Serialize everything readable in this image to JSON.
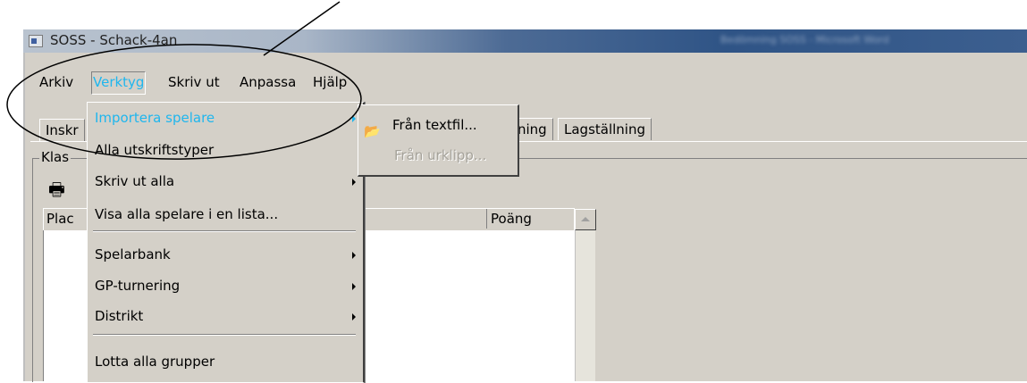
{
  "window": {
    "title": "SOSS - Schack-4an",
    "blurred_title": "Bedömning SOSS - Microsoft Word"
  },
  "menubar": {
    "items": [
      {
        "label": "Arkiv"
      },
      {
        "label": "Verktyg",
        "active": true
      },
      {
        "label": "Skriv ut"
      },
      {
        "label": "Anpassa"
      },
      {
        "label": "Hjälp"
      }
    ]
  },
  "tabs": [
    {
      "label": "Inskr"
    },
    {
      "label": "ning"
    },
    {
      "label": "Lagställning"
    }
  ],
  "group": {
    "label": "Klas"
  },
  "list": {
    "columns": [
      {
        "label": "Plac"
      },
      {
        "label": "Poäng"
      }
    ]
  },
  "dropdown": {
    "items": [
      {
        "label": "Importera spelare",
        "submenu": true,
        "highlighted": true
      },
      {
        "label": "Alla utskriftstyper"
      },
      {
        "label": "Skriv ut alla",
        "submenu": true
      },
      {
        "label": "Visa alla spelare i en lista..."
      },
      {
        "label": "Spelarbank",
        "submenu": true
      },
      {
        "label": "GP-turnering",
        "submenu": true
      },
      {
        "label": "Distrikt",
        "submenu": true
      },
      {
        "label": "Lotta alla grupper"
      }
    ]
  },
  "submenu": {
    "items": [
      {
        "label": "Från textfil...",
        "icon": "folder-open-icon"
      },
      {
        "label": "Från urklipp...",
        "disabled": true
      }
    ]
  },
  "icons": {
    "print": "printer-icon",
    "app": "app-icon"
  },
  "colors": {
    "highlight_text": "#1fb6ee",
    "face": "#d4d0c8"
  }
}
